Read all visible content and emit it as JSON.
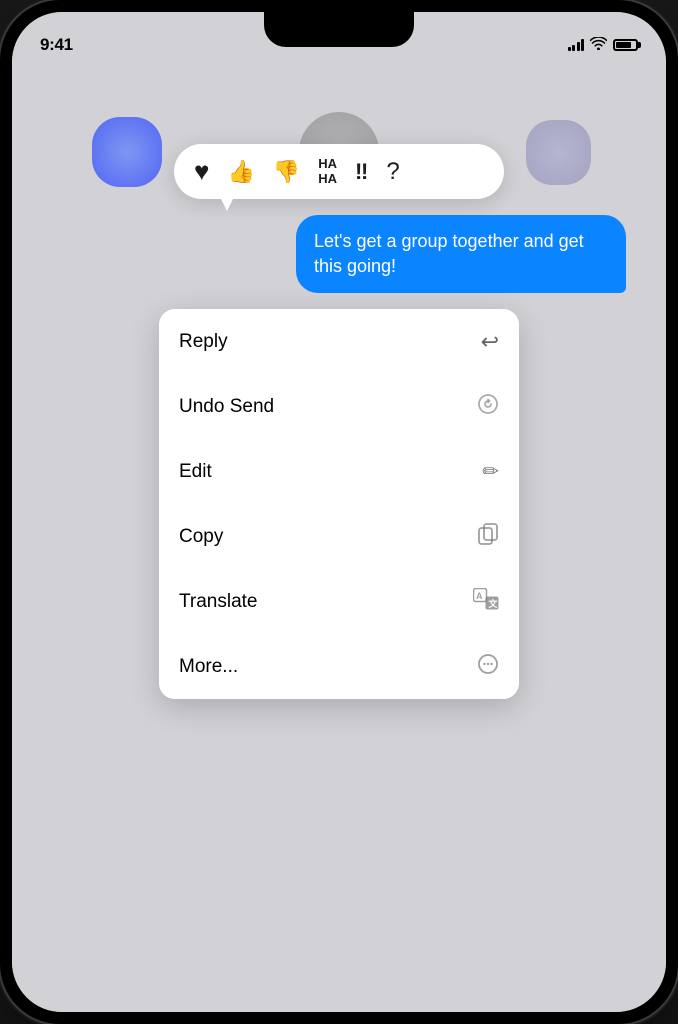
{
  "phone": {
    "time": "9:41",
    "accent_color": "#0b84ff"
  },
  "reactions": {
    "items": [
      {
        "id": "heart",
        "emoji": "♥",
        "label": "Heart"
      },
      {
        "id": "thumbsup",
        "emoji": "👍",
        "label": "Thumbs Up"
      },
      {
        "id": "thumbsdown",
        "emoji": "👎",
        "label": "Thumbs Down"
      },
      {
        "id": "haha",
        "text": "HA\nHA",
        "label": "Haha"
      },
      {
        "id": "exclamation",
        "emoji": "‼",
        "label": "Exclamation"
      },
      {
        "id": "question",
        "emoji": "?",
        "label": "Question"
      }
    ]
  },
  "message": {
    "text": "Let's get a group together and get this going!"
  },
  "context_menu": {
    "items": [
      {
        "id": "reply",
        "label": "Reply",
        "icon": "↩"
      },
      {
        "id": "undo-send",
        "label": "Undo Send",
        "icon": "↺"
      },
      {
        "id": "edit",
        "label": "Edit",
        "icon": "✏"
      },
      {
        "id": "copy",
        "label": "Copy",
        "icon": "⧉"
      },
      {
        "id": "translate",
        "label": "Translate",
        "icon": "🔤"
      },
      {
        "id": "more",
        "label": "More...",
        "icon": "···"
      }
    ]
  }
}
